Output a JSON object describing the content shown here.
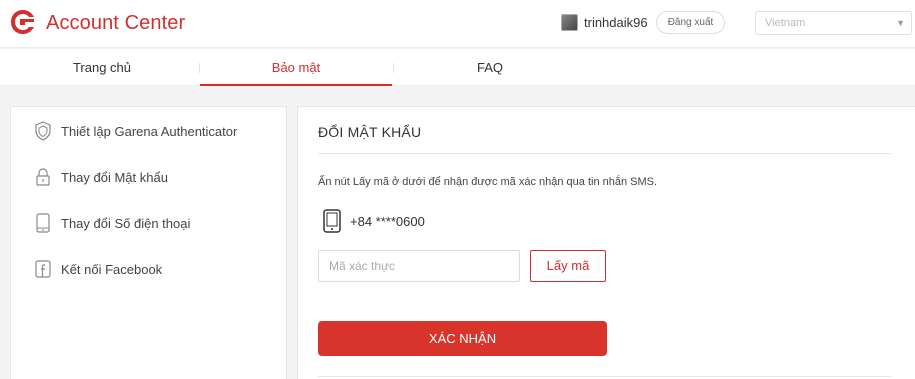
{
  "header": {
    "app_title": "Account Center",
    "username": "trinhdaik96",
    "logout_label": "Đăng xuất",
    "country_selected": "Vietnam",
    "brand_color": "#d32f2f"
  },
  "nav": {
    "tabs": [
      {
        "label": "Trang chủ",
        "active": false
      },
      {
        "label": "Bảo mật",
        "active": true
      },
      {
        "label": "FAQ",
        "active": false
      }
    ]
  },
  "sidebar": {
    "items": [
      {
        "label": "Thiết lập Garena Authenticator",
        "icon": "shield-icon"
      },
      {
        "label": "Thay đổi Mật khẩu",
        "icon": "lock-icon"
      },
      {
        "label": "Thay đổi Số điện thoại",
        "icon": "phone-icon"
      },
      {
        "label": "Kết nối Facebook",
        "icon": "facebook-icon"
      }
    ]
  },
  "main": {
    "title": "ĐỔI MẬT KHẨU",
    "instruction": "Ấn nút Lấy mã ở dưới để nhận được mã xác nhận qua tin nhắn SMS.",
    "phone_number": "+84 ****0600",
    "code_placeholder": "Mã xác thực",
    "get_code_label": "Lấy mã",
    "confirm_label": "XÁC NHẬN"
  }
}
